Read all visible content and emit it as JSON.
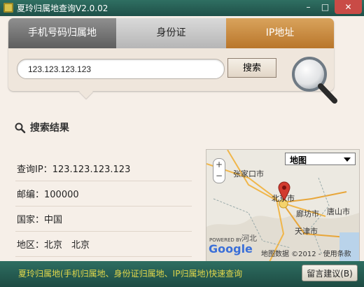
{
  "window": {
    "title": "夏玲归属地查询V2.0.02",
    "controls": {
      "minimize": "–",
      "maximize": "□",
      "close": "✕"
    }
  },
  "tabs": [
    {
      "label": "手机号码归属地"
    },
    {
      "label": "身份证"
    },
    {
      "label": "IP地址",
      "active": true
    }
  ],
  "search": {
    "value": "123.123.123.123",
    "button_label": "搜索"
  },
  "results": {
    "heading": "搜索结果",
    "rows": [
      {
        "label": "查询IP：",
        "value": "123.123.123.123"
      },
      {
        "label": "邮编：",
        "value": "100000"
      },
      {
        "label": "国家：",
        "value": "中国"
      },
      {
        "label": "地区：",
        "value": "北京　北京"
      }
    ]
  },
  "map": {
    "type_selected": "地图",
    "zoom_in": "+",
    "zoom_out": "−",
    "places": {
      "zhangjiakou": "张家口市",
      "beijing": "北京市",
      "langfang": "廊坊市",
      "tangshan": "唐山市",
      "tianjin": "天津市",
      "hebei": "河北"
    },
    "powered_by": "POWERED BY",
    "google": "Google",
    "map_data": "地图数据 ©2012 - 使用条款",
    "pin_color": "#d23b2f"
  },
  "status": {
    "text": "夏玲归属地(手机归属地、身份证归属地、IP归属地)快速查询",
    "feedback_button": "留言建议(B)"
  },
  "colors": {
    "titlebar": "#2f6f62",
    "status_text": "#e0d64b",
    "active_tab": "#c98a3e"
  }
}
